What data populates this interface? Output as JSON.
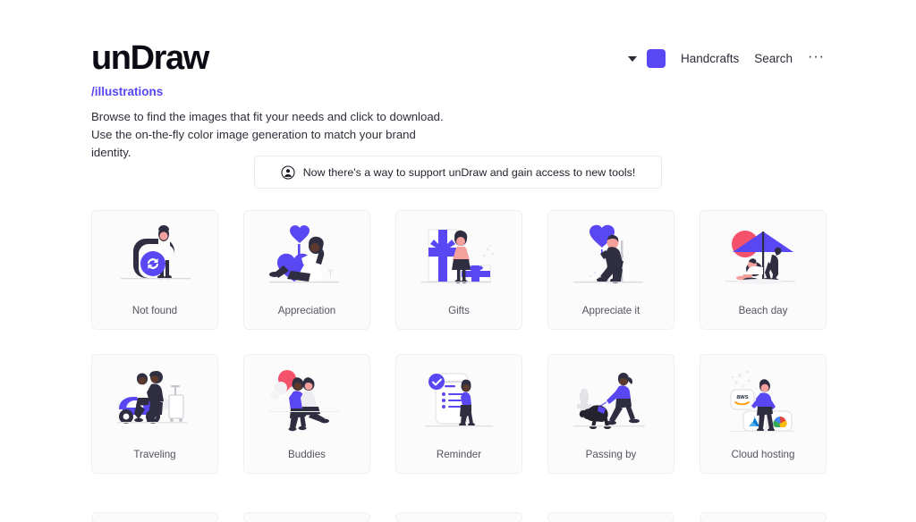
{
  "header": {
    "logo": "unDraw",
    "color_swatch": "#5847f2",
    "nav": [
      {
        "label": "Handcrafts",
        "name": "nav-handcrafts"
      },
      {
        "label": "Search",
        "name": "nav-search"
      }
    ],
    "more_label": "···"
  },
  "intro": {
    "breadcrumb": "/illustrations",
    "description": "Browse to find the images that fit your needs and click to download. Use the on-the-fly color image generation to match your brand identity."
  },
  "banner": {
    "icon": "user-circle-icon",
    "text": "Now there's a way to support unDraw and gain access to new tools!"
  },
  "theme": {
    "accent": "#5847f2",
    "accent_dark": "#2f2e41",
    "pink": "#f4526a",
    "card_bg": "#fbfbfc",
    "card_border": "#f0f0f2",
    "text": "#2e2e3a",
    "label": "#54545f"
  },
  "gallery": {
    "rows": [
      [
        {
          "label": "Not found",
          "art": "not-found"
        },
        {
          "label": "Appreciation",
          "art": "appreciation"
        },
        {
          "label": "Gifts",
          "art": "gifts"
        },
        {
          "label": "Appreciate it",
          "art": "appreciate-it"
        },
        {
          "label": "Beach day",
          "art": "beach-day"
        }
      ],
      [
        {
          "label": "Traveling",
          "art": "traveling"
        },
        {
          "label": "Buddies",
          "art": "buddies"
        },
        {
          "label": "Reminder",
          "art": "reminder"
        },
        {
          "label": "Passing by",
          "art": "passing-by"
        },
        {
          "label": "Cloud hosting",
          "art": "cloud-hosting"
        }
      ]
    ],
    "partial_row_count": 5
  }
}
